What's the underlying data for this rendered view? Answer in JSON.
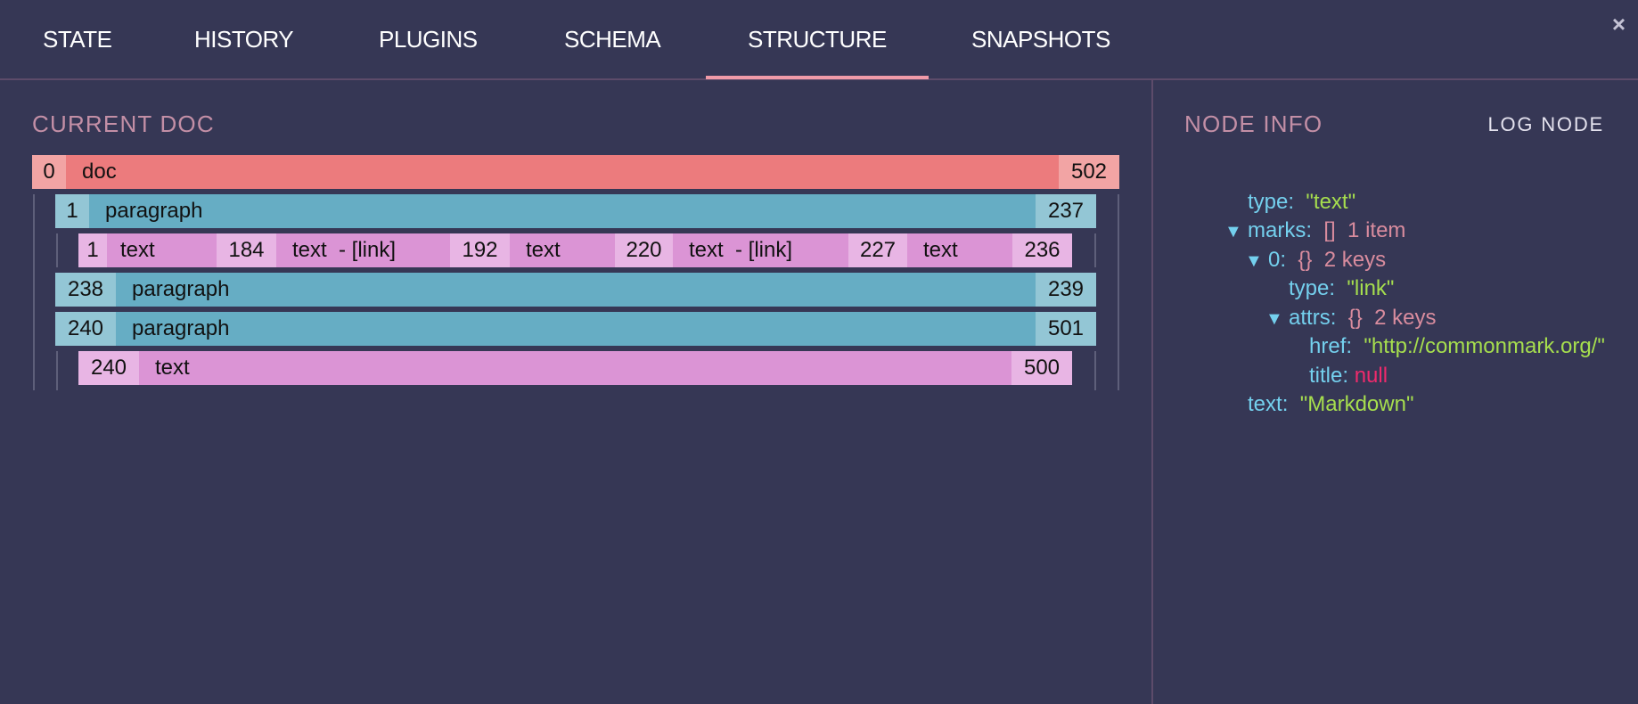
{
  "tabs": [
    {
      "label": "STATE",
      "active": false
    },
    {
      "label": "HISTORY",
      "active": false
    },
    {
      "label": "PLUGINS",
      "active": false
    },
    {
      "label": "SCHEMA",
      "active": false
    },
    {
      "label": "STRUCTURE",
      "active": true
    },
    {
      "label": "SNAPSHOTS",
      "active": false
    }
  ],
  "close_icon": "×",
  "current_doc": {
    "title": "CURRENT DOC",
    "doc": {
      "start": "0",
      "name": "doc",
      "end": "502"
    },
    "paragraph1": {
      "start": "1",
      "name": "paragraph",
      "end": "237"
    },
    "text_row1": [
      {
        "start": "1",
        "name": "text"
      },
      {
        "start": "184",
        "name": "text  - [link]"
      },
      {
        "start": "192",
        "name": "text"
      },
      {
        "start": "220",
        "name": "text  - [link]"
      },
      {
        "start": "227",
        "name": "text"
      },
      {
        "end": "236"
      }
    ],
    "paragraph2": {
      "start": "238",
      "name": "paragraph",
      "end": "239"
    },
    "paragraph3": {
      "start": "240",
      "name": "paragraph",
      "end": "501"
    },
    "text_row2": {
      "start": "240",
      "name": "text",
      "end": "500"
    }
  },
  "node_info": {
    "title": "NODE INFO",
    "log_button": "LOG NODE",
    "arrow": "▼",
    "rows": [
      {
        "key": "type:",
        "value": "\"text\""
      },
      {
        "key": "marks:",
        "meta_bracket": "[]",
        "meta": "1 item"
      },
      {
        "key": "0:",
        "meta_bracket": "{}",
        "meta": "2 keys"
      },
      {
        "key": "type:",
        "value": "\"link\""
      },
      {
        "key": "attrs:",
        "meta_bracket": "{}",
        "meta": "2 keys"
      },
      {
        "key": "href:",
        "value": "\"http://commonmark.org/\""
      },
      {
        "key": "title:",
        "value": "null"
      },
      {
        "key": "text:",
        "value": "\"Markdown\""
      }
    ]
  },
  "colors": {
    "background": "#363755",
    "doc": "#ec7b7d",
    "paragraph": "#66adc4",
    "text": "#db94d5",
    "active_tab_underline": "#f09aa8",
    "key": "#74d0ee",
    "string": "#a6de4e",
    "null": "#f02a6c"
  }
}
